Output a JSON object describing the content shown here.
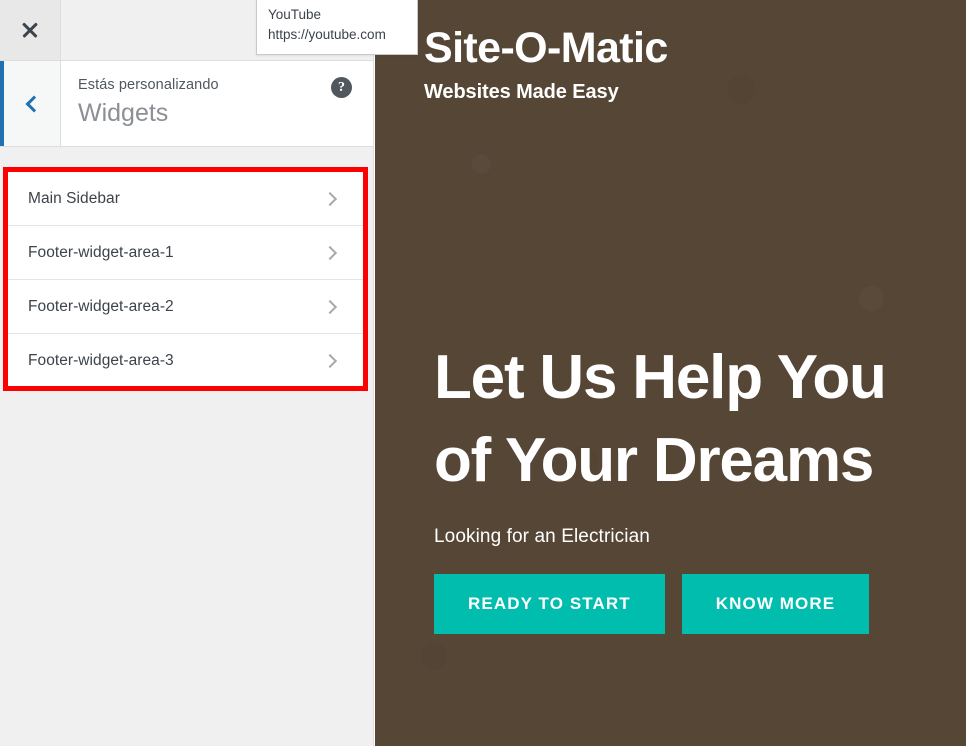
{
  "panel": {
    "close_label": "×",
    "back_label": "‹",
    "eyebrow": "Estás personalizando",
    "title": "Widgets",
    "help_label": "?",
    "widget_areas": [
      {
        "label": "Main Sidebar"
      },
      {
        "label": "Footer-widget-area-1"
      },
      {
        "label": "Footer-widget-area-2"
      },
      {
        "label": "Footer-widget-area-3"
      }
    ],
    "highlight_color": "#ff0000",
    "accent_color": "#2271b1"
  },
  "tooltip": {
    "title": "YouTube",
    "url": "https://youtube.com"
  },
  "preview": {
    "background_color": "#564636",
    "site_title": "Site-O-Matic",
    "site_tagline": "Websites Made Easy",
    "hero_line1": "Let Us Help You",
    "hero_line2": "of Your Dreams",
    "hero_sub": "Looking for an Electrician",
    "button_color": "#00bdae",
    "buttons": [
      {
        "label": "READY TO START"
      },
      {
        "label": "KNOW MORE"
      }
    ]
  }
}
